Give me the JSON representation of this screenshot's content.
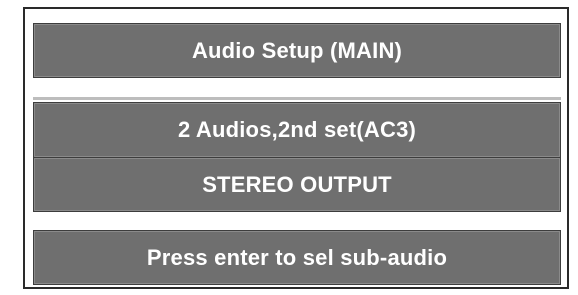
{
  "menu": {
    "title": "Audio Setup (MAIN)",
    "audio_mode": "2 Audios,2nd set(AC3)",
    "output_mode": "STEREO OUTPUT",
    "hint": "Press enter to sel sub-audio"
  },
  "colors": {
    "bar_fill": "#6f6f6f",
    "text": "#ffffff",
    "frame_border": "#2a2a2a",
    "background": "#ffffff"
  }
}
